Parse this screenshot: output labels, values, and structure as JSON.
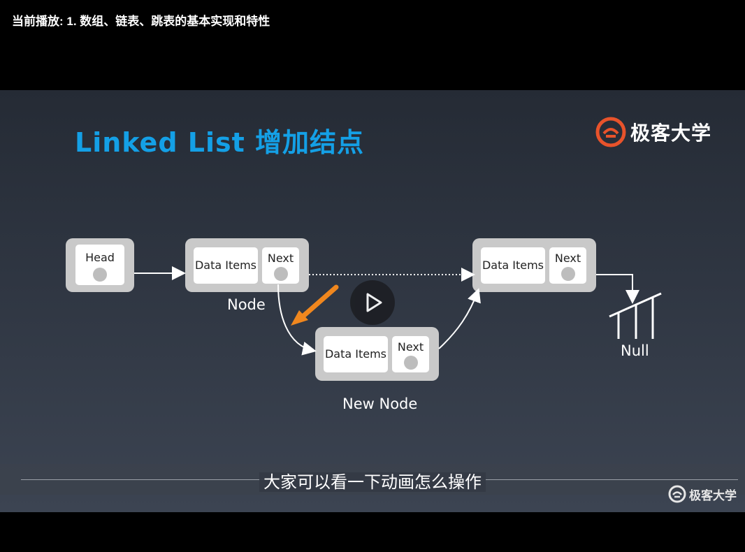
{
  "player": {
    "now_playing": "当前播放: 1. 数组、链表、跳表的基本实现和特性"
  },
  "slide": {
    "title": "Linked List 增加结点",
    "brand": "极客大学",
    "head_label": "Head",
    "node1": {
      "data_label": "Data Items",
      "next_label": "Next",
      "caption": "Node"
    },
    "node2": {
      "data_label": "Data Items",
      "next_label": "Next"
    },
    "new_node": {
      "data_label": "Data Items",
      "next_label": "Next",
      "caption": "New Node"
    },
    "null_label": "Null"
  },
  "subtitle": "大家可以看一下动画怎么操作",
  "watermark": "极客大学",
  "colors": {
    "title": "#14a0e6",
    "brand": "#e8532b",
    "arrow": "#f0871e"
  },
  "icons": {
    "play": "play-icon",
    "brand": "geek-logo-icon"
  }
}
